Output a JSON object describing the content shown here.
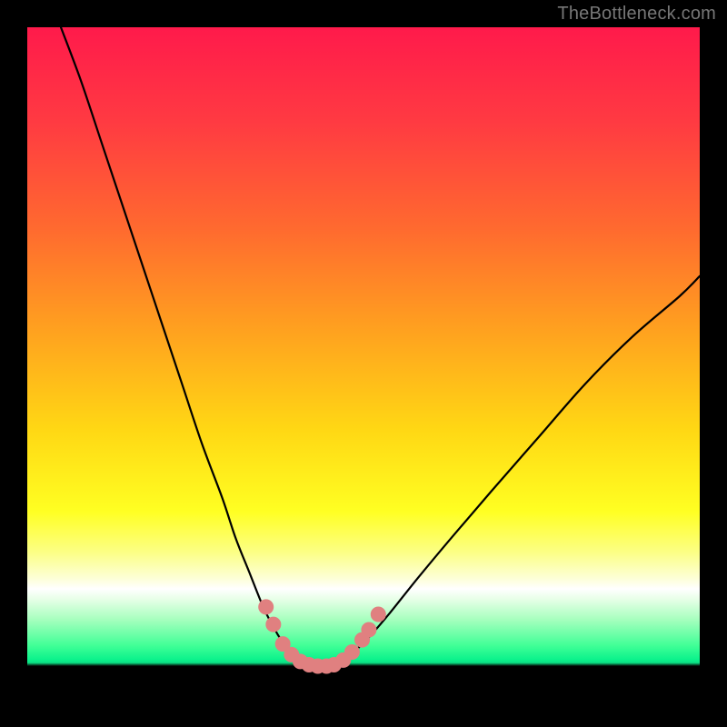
{
  "watermark": "TheBottleneck.com",
  "chart_data": {
    "type": "line",
    "title": "",
    "xlabel": "",
    "ylabel": "",
    "xlim": [
      0,
      100
    ],
    "ylim": [
      0,
      100
    ],
    "gradient_stops": [
      {
        "offset": 0.0,
        "color": "#ff1a4b"
      },
      {
        "offset": 0.14,
        "color": "#ff3a42"
      },
      {
        "offset": 0.3,
        "color": "#ff6a2f"
      },
      {
        "offset": 0.45,
        "color": "#ffa11f"
      },
      {
        "offset": 0.6,
        "color": "#ffd814"
      },
      {
        "offset": 0.72,
        "color": "#ffff22"
      },
      {
        "offset": 0.78,
        "color": "#fcff84"
      },
      {
        "offset": 0.82,
        "color": "#fdffd8"
      },
      {
        "offset": 0.835,
        "color": "#ffffff"
      },
      {
        "offset": 0.85,
        "color": "#e8ffe8"
      },
      {
        "offset": 0.88,
        "color": "#a8ffbf"
      },
      {
        "offset": 0.92,
        "color": "#3fff96"
      },
      {
        "offset": 0.94,
        "color": "#0cf28c"
      },
      {
        "offset": 0.945,
        "color": "#0ce085"
      },
      {
        "offset": 0.95,
        "color": "#000000"
      },
      {
        "offset": 1.0,
        "color": "#000000"
      }
    ],
    "series": [
      {
        "name": "left-curve",
        "x": [
          5,
          8,
          11,
          14,
          17,
          20,
          23,
          26,
          29,
          31,
          33,
          35,
          36.5,
          38,
          39.5,
          41,
          42
        ],
        "y": [
          100,
          92,
          83,
          74,
          65,
          56,
          47,
          38,
          30,
          24,
          19,
          14,
          11,
          8.5,
          6.5,
          5.2,
          5
        ]
      },
      {
        "name": "right-curve",
        "x": [
          45,
          46,
          47.5,
          49,
          51,
          54,
          58,
          63,
          69,
          76,
          83,
          90,
          97,
          100
        ],
        "y": [
          5,
          5.3,
          6.2,
          7.5,
          9.5,
          13,
          18,
          24,
          31,
          39,
          47,
          54,
          60,
          63
        ]
      }
    ],
    "marker_band": {
      "y_range": [
        5.5,
        20
      ],
      "color": "#e08080",
      "radius_px": 8
    },
    "markers": [
      {
        "x": 35.5,
        "y": 13.8
      },
      {
        "x": 36.6,
        "y": 11.2
      },
      {
        "x": 38.0,
        "y": 8.3
      },
      {
        "x": 39.3,
        "y": 6.7
      },
      {
        "x": 40.6,
        "y": 5.7
      },
      {
        "x": 41.9,
        "y": 5.2
      },
      {
        "x": 43.2,
        "y": 5.0
      },
      {
        "x": 44.5,
        "y": 5.0
      },
      {
        "x": 45.6,
        "y": 5.2
      },
      {
        "x": 47.0,
        "y": 5.9
      },
      {
        "x": 48.3,
        "y": 7.1
      },
      {
        "x": 49.8,
        "y": 8.9
      },
      {
        "x": 50.8,
        "y": 10.4
      },
      {
        "x": 52.2,
        "y": 12.7
      }
    ]
  }
}
